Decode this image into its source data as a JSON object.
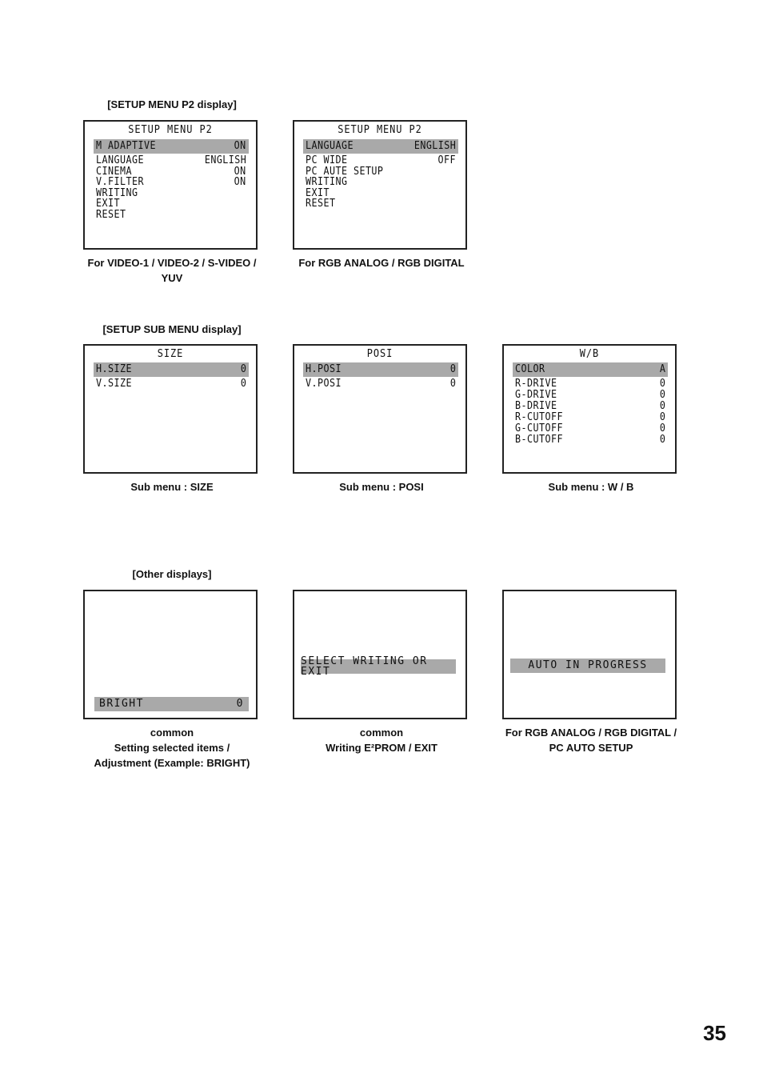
{
  "sections": {
    "p2": "[SETUP MENU P2 display]",
    "sub": "[SETUP SUB MENU display]",
    "other": "[Other displays]"
  },
  "screens": {
    "video": {
      "title": "SETUP MENU P2",
      "rows": [
        {
          "label": "M ADAPTIVE",
          "value": "ON",
          "highlighted": true
        },
        {
          "label": "LANGUAGE",
          "value": "ENGLISH"
        },
        {
          "label": "CINEMA",
          "value": "ON"
        },
        {
          "label": "V.FILTER",
          "value": "ON"
        },
        {
          "label": "WRITING",
          "value": ""
        },
        {
          "label": "EXIT",
          "value": ""
        },
        {
          "label": "RESET",
          "value": ""
        }
      ],
      "caption_line1": "For VIDEO-1 / VIDEO-2 / S-VIDEO /",
      "caption_line2": "YUV"
    },
    "rgb": {
      "title": "SETUP MENU P2",
      "rows": [
        {
          "label": "LANGUAGE",
          "value": "ENGLISH",
          "highlighted": true
        },
        {
          "label": "PC WIDE",
          "value": "OFF"
        },
        {
          "label": "PC AUTE SETUP",
          "value": ""
        },
        {
          "label": "WRITING",
          "value": ""
        },
        {
          "label": "EXIT",
          "value": ""
        },
        {
          "label": "RESET",
          "value": ""
        }
      ],
      "caption_line1": "For RGB ANALOG / RGB DIGITAL"
    },
    "size": {
      "title": "SIZE",
      "rows": [
        {
          "label": "H.SIZE",
          "value": "0",
          "highlighted": true
        },
        {
          "label": "V.SIZE",
          "value": "0"
        }
      ],
      "caption_line1": "Sub menu : SIZE"
    },
    "posi": {
      "title": "POSI",
      "rows": [
        {
          "label": "H.POSI",
          "value": "0",
          "highlighted": true
        },
        {
          "label": "V.POSI",
          "value": "0"
        }
      ],
      "caption_line1": "Sub menu : POSI"
    },
    "wb": {
      "title": "W/B",
      "rows": [
        {
          "label": "COLOR",
          "value": "A",
          "highlighted": true
        },
        {
          "label": "R-DRIVE",
          "value": "0"
        },
        {
          "label": "G-DRIVE",
          "value": "0"
        },
        {
          "label": "B-DRIVE",
          "value": "0"
        },
        {
          "label": "R-CUTOFF",
          "value": "0"
        },
        {
          "label": "G-CUTOFF",
          "value": "0"
        },
        {
          "label": "B-CUTOFF",
          "value": "0"
        }
      ],
      "caption_line1": "Sub menu : W / B"
    },
    "bright": {
      "label": "BRIGHT",
      "value": "0",
      "caption_line1": "common",
      "caption_line2": "Setting selected items /",
      "caption_line3": "Adjustment (Example: BRIGHT)"
    },
    "writing": {
      "message": "SELECT WRITING OR EXIT",
      "caption_line1": "common",
      "caption_line2": "Writing E²PROM / EXIT"
    },
    "auto": {
      "message": "AUTO IN PROGRESS",
      "caption_line1": "For RGB ANALOG / RGB DIGITAL /",
      "caption_line2": "PC AUTO SETUP"
    }
  },
  "page_number": "35",
  "colors": {
    "highlight": "#a9a9a9",
    "border": "#222222"
  }
}
